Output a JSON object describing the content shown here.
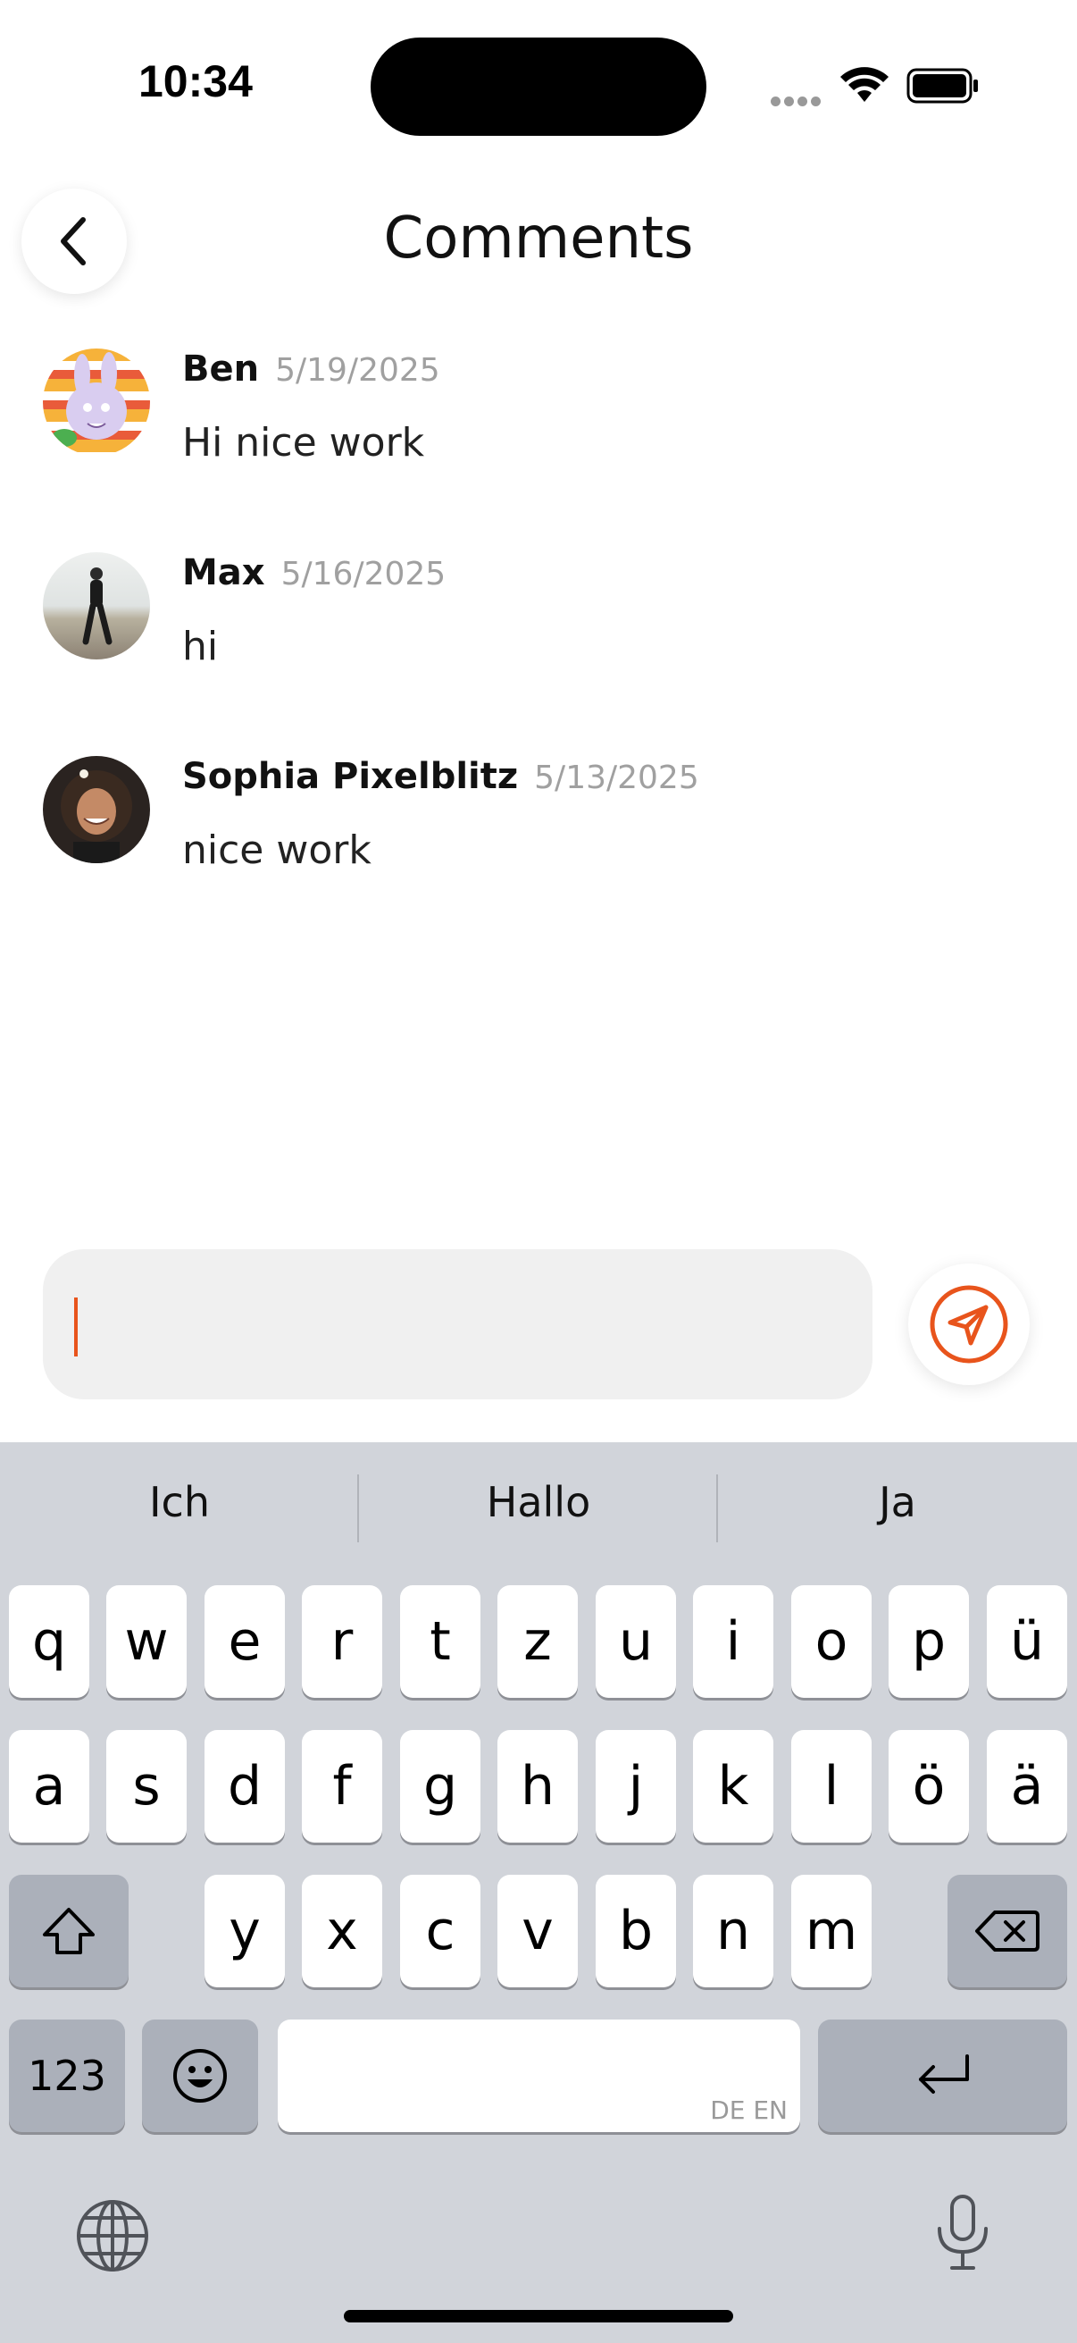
{
  "status_bar": {
    "time": "10:34"
  },
  "header": {
    "title": "Comments"
  },
  "comments": [
    {
      "author": "Ben",
      "date": "5/19/2025",
      "text": "Hi nice work"
    },
    {
      "author": "Max",
      "date": "5/16/2025",
      "text": "hi"
    },
    {
      "author": "Sophia Pixelblitz",
      "date": "5/13/2025",
      "text": "nice work"
    }
  ],
  "composer": {
    "value": "",
    "accent_color": "#e8541c"
  },
  "keyboard": {
    "suggestions": [
      "Ich",
      "Hallo",
      "Ja"
    ],
    "row1": [
      "q",
      "w",
      "e",
      "r",
      "t",
      "z",
      "u",
      "i",
      "o",
      "p",
      "ü"
    ],
    "row2": [
      "a",
      "s",
      "d",
      "f",
      "g",
      "h",
      "j",
      "k",
      "l",
      "ö",
      "ä"
    ],
    "row3": [
      "y",
      "x",
      "c",
      "v",
      "b",
      "n",
      "m"
    ],
    "numbers_label": "123",
    "space_languages": "DE EN"
  }
}
